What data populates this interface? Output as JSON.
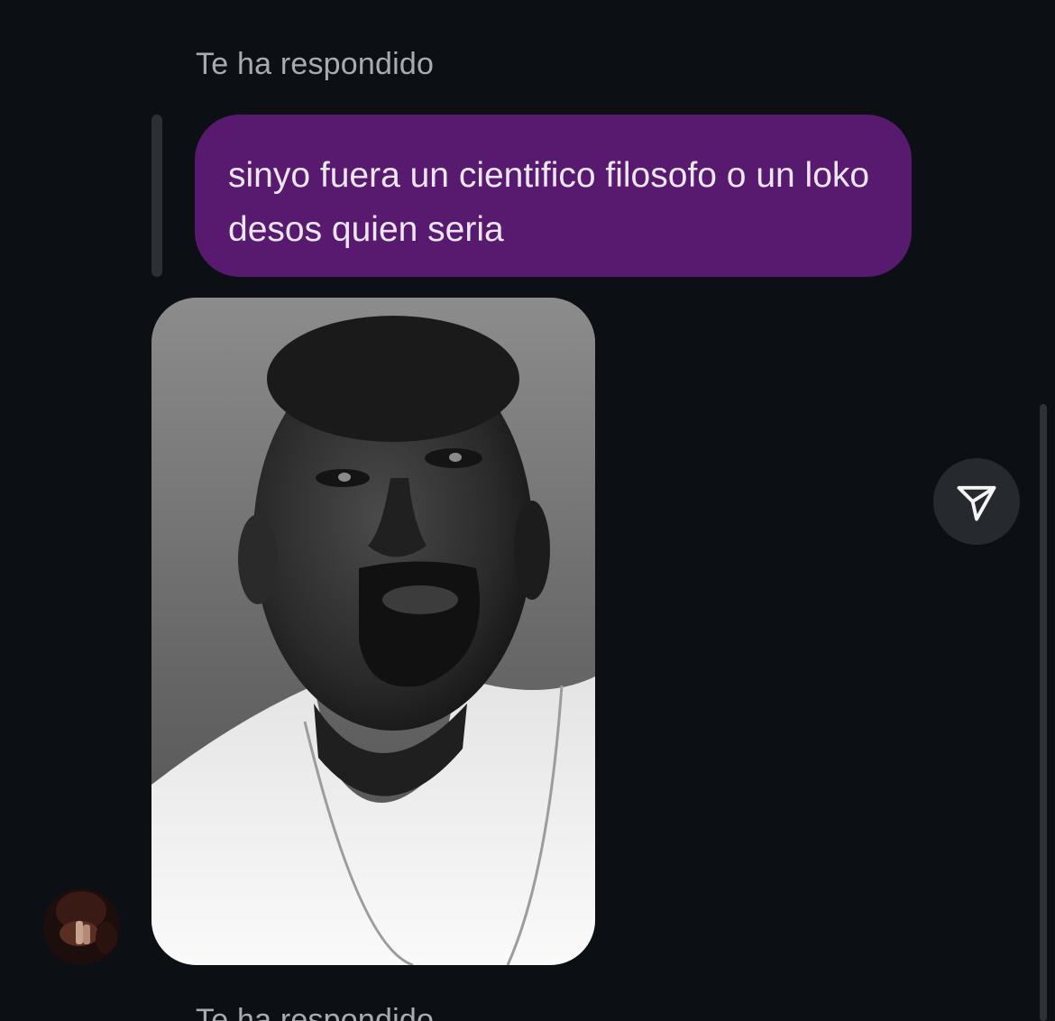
{
  "thread": {
    "reply_label": "Te ha respondido",
    "quoted_message": "sinyo fuera un cientifico filosofo o un loko desos quien seria",
    "next_reply_label": "Te ha respondido"
  },
  "icons": {
    "share": "paper-plane-icon"
  },
  "colors": {
    "background": "#0c1014",
    "quoted_bubble": "#571a6e",
    "label_text": "#a8acb1",
    "share_button": "#262a2f"
  }
}
